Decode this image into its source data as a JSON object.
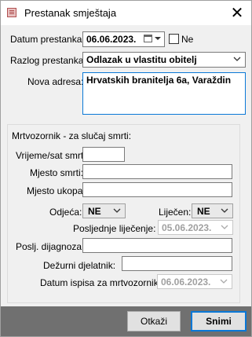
{
  "window": {
    "title": "Prestanak smještaja",
    "close_glyph": "✕"
  },
  "form": {
    "datum_prestanka_label": "Datum prestanka:",
    "datum_prestanka_value": "06.06.2023.",
    "ne_label": "Ne",
    "razlog_label": "Razlog prestanka:",
    "razlog_value": "Odlazak u vlastitu obitelj",
    "nova_adresa_label": "Nova adresa:",
    "nova_adresa_value": "Hrvatskih branitelja 6a, Varaždin"
  },
  "death_group": {
    "title": "Mrtvozornik - za slučaj smrti:",
    "vrijeme_label": "Vrijeme/sat smrti:",
    "vrijeme_value": "",
    "mjesto_smrti_label": "Mjesto smrti:",
    "mjesto_smrti_value": "",
    "mjesto_ukopa_label": "Mjesto ukopa:",
    "mjesto_ukopa_value": "",
    "odjeca_label": "Odjeća:",
    "odjeca_value": "NE",
    "lijecen_label": "Liječen:",
    "lijecen_value": "NE",
    "posljednje_label": "Posljednje liječenje:",
    "posljednje_value": "05.06.2023.",
    "dijagnoza_label": "Poslj. dijagnoza:",
    "dijagnoza_value": "",
    "dezurni_label": "Dežurni djelatnik:",
    "dezurni_value": "",
    "datum_ispisa_label": "Datum ispisa za mrtvozornika:",
    "datum_ispisa_value": "06.06.2023."
  },
  "buttons": {
    "cancel": "Otkaži",
    "save": "Snimi"
  }
}
